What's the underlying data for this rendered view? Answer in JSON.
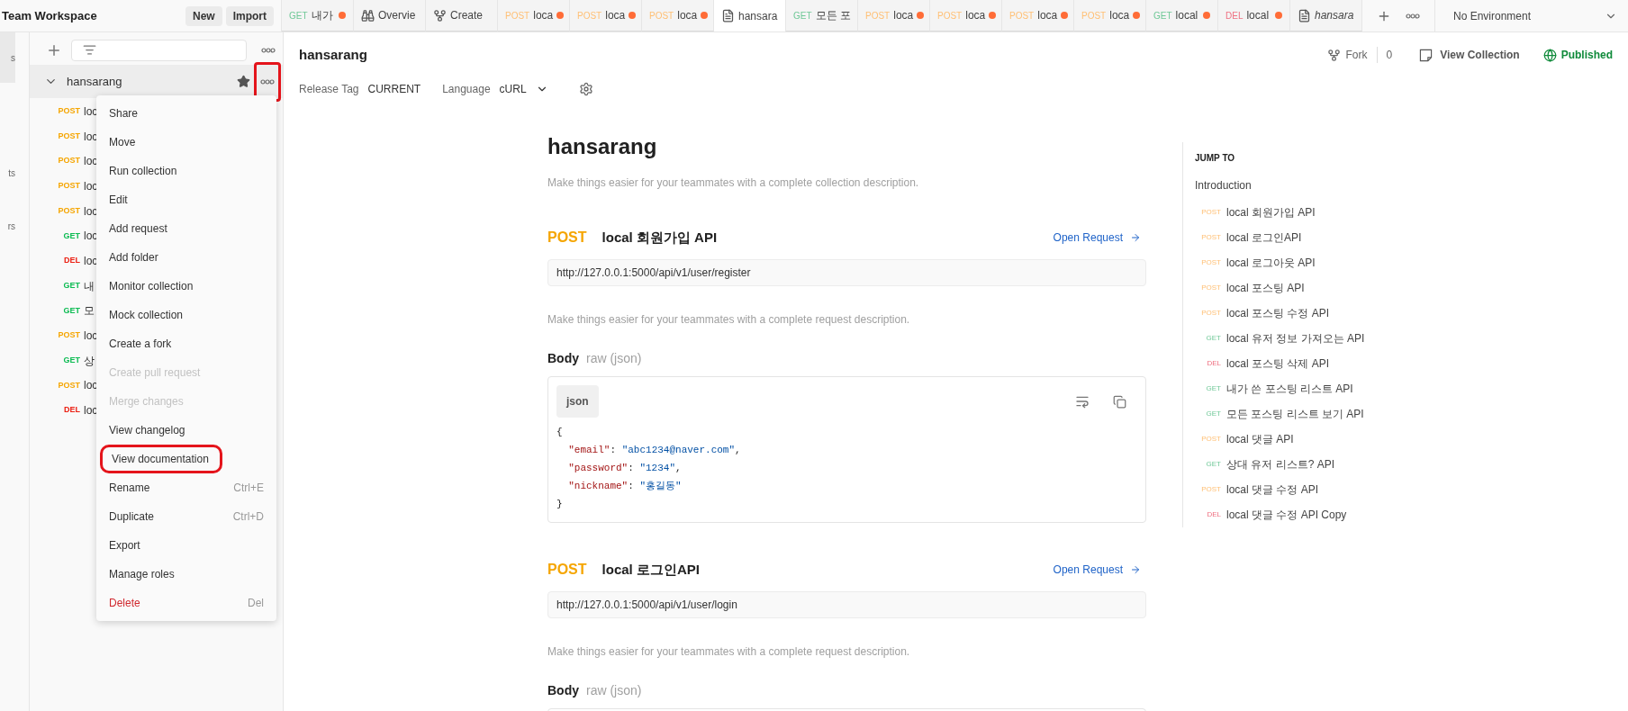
{
  "workspace": {
    "title": "Team Workspace",
    "buttons": [
      "New",
      "Import"
    ]
  },
  "tabs": [
    {
      "kind": "request",
      "method": "GET",
      "label": "내가",
      "unsaved": true,
      "selected": false,
      "preview": false
    },
    {
      "kind": "overview",
      "label": "Overvie",
      "unsaved": false,
      "selected": false,
      "preview": false
    },
    {
      "kind": "fork",
      "label": "Create",
      "unsaved": false,
      "selected": false,
      "preview": false
    },
    {
      "kind": "request",
      "method": "POST",
      "label": "loca",
      "unsaved": true,
      "selected": false,
      "preview": false
    },
    {
      "kind": "request",
      "method": "POST",
      "label": "loca",
      "unsaved": true,
      "selected": false,
      "preview": false
    },
    {
      "kind": "request",
      "method": "POST",
      "label": "loca",
      "unsaved": true,
      "selected": false,
      "preview": false
    },
    {
      "kind": "collection",
      "label": "hansara",
      "unsaved": false,
      "selected": true,
      "preview": false
    },
    {
      "kind": "request",
      "method": "GET",
      "label": "모든 포",
      "unsaved": false,
      "selected": false,
      "preview": false
    },
    {
      "kind": "request",
      "method": "POST",
      "label": "loca",
      "unsaved": true,
      "selected": false,
      "preview": false
    },
    {
      "kind": "request",
      "method": "POST",
      "label": "loca",
      "unsaved": true,
      "selected": false,
      "preview": false
    },
    {
      "kind": "request",
      "method": "POST",
      "label": "loca",
      "unsaved": true,
      "selected": false,
      "preview": false
    },
    {
      "kind": "request",
      "method": "POST",
      "label": "loca",
      "unsaved": true,
      "selected": false,
      "preview": false
    },
    {
      "kind": "request",
      "method": "GET",
      "label": "local",
      "unsaved": true,
      "selected": false,
      "preview": false
    },
    {
      "kind": "request",
      "method": "DEL",
      "label": "local",
      "unsaved": true,
      "selected": false,
      "preview": false
    },
    {
      "kind": "collection",
      "label": "hansara",
      "unsaved": false,
      "selected": false,
      "preview": true
    }
  ],
  "environment": {
    "label": "No Environment"
  },
  "nav_strip": [
    {
      "label": "s",
      "selected": true
    },
    {
      "label": "ts",
      "selected": false
    },
    {
      "label": "rs",
      "selected": false
    }
  ],
  "sidebar": {
    "collection": {
      "name": "hansarang",
      "expanded": true,
      "starred": true,
      "more_annotated": true,
      "requests": [
        {
          "method": "POST",
          "name": "loc"
        },
        {
          "method": "POST",
          "name": "loc"
        },
        {
          "method": "POST",
          "name": "loc"
        },
        {
          "method": "POST",
          "name": "loc"
        },
        {
          "method": "POST",
          "name": "loc"
        },
        {
          "method": "GET",
          "name": "loc"
        },
        {
          "method": "DEL",
          "name": "loc"
        },
        {
          "method": "GET",
          "name": "내"
        },
        {
          "method": "GET",
          "name": "모"
        },
        {
          "method": "POST",
          "name": "loc"
        },
        {
          "method": "GET",
          "name": "상"
        },
        {
          "method": "POST",
          "name": "loc"
        },
        {
          "method": "DEL",
          "name": "loc"
        }
      ]
    }
  },
  "context_menu": [
    {
      "label": "Share",
      "disabled": false,
      "kind": "normal",
      "annotated": false
    },
    {
      "label": "Move",
      "disabled": false,
      "kind": "normal",
      "annotated": false
    },
    {
      "label": "Run collection",
      "disabled": false,
      "kind": "normal",
      "annotated": false
    },
    {
      "label": "Edit",
      "disabled": false,
      "kind": "normal",
      "annotated": false
    },
    {
      "label": "Add request",
      "disabled": false,
      "kind": "normal",
      "annotated": false
    },
    {
      "label": "Add folder",
      "disabled": false,
      "kind": "normal",
      "annotated": false
    },
    {
      "label": "Monitor collection",
      "disabled": false,
      "kind": "normal",
      "annotated": false
    },
    {
      "label": "Mock collection",
      "disabled": false,
      "kind": "normal",
      "annotated": false
    },
    {
      "label": "Create a fork",
      "disabled": false,
      "kind": "normal",
      "annotated": false
    },
    {
      "label": "Create pull request",
      "disabled": true,
      "kind": "normal",
      "annotated": false
    },
    {
      "label": "Merge changes",
      "disabled": true,
      "kind": "normal",
      "annotated": false
    },
    {
      "label": "View changelog",
      "disabled": false,
      "kind": "normal",
      "annotated": false
    },
    {
      "label": "View documentation",
      "disabled": false,
      "kind": "normal",
      "annotated": true
    },
    {
      "label": "Rename",
      "shortcut": "Ctrl+E",
      "disabled": false,
      "kind": "normal",
      "annotated": false
    },
    {
      "label": "Duplicate",
      "shortcut": "Ctrl+D",
      "disabled": false,
      "kind": "normal",
      "annotated": false
    },
    {
      "label": "Export",
      "disabled": false,
      "kind": "normal",
      "annotated": false
    },
    {
      "label": "Manage roles",
      "disabled": false,
      "kind": "normal",
      "annotated": false
    },
    {
      "label": "Delete",
      "shortcut": "Del",
      "disabled": false,
      "kind": "danger",
      "annotated": false
    }
  ],
  "header": {
    "title": "hansarang",
    "fork_label": "Fork",
    "fork_count": "0",
    "view_collection": "View Collection",
    "status": "Published",
    "release_tag_label": "Release Tag",
    "release_tag": "CURRENT",
    "language_label": "Language",
    "language": "cURL"
  },
  "doc": {
    "title": "hansarang",
    "description": "Make things easier for your teammates with a complete collection description.",
    "requests": [
      {
        "method": "POST",
        "name": "local 회원가입 API",
        "open_label": "Open Request",
        "url": "http://127.0.0.1:5000/api/v1/user/register",
        "description": "Make things easier for your teammates with a complete request description.",
        "body_label": "Body",
        "body_type": "raw (json)",
        "code_lang": "json",
        "code": [
          [
            {
              "kind": "punct",
              "text": "{"
            }
          ],
          [
            {
              "kind": "key",
              "text": "  \"email\""
            },
            {
              "kind": "punct",
              "text": ": "
            },
            {
              "kind": "string",
              "text": "\"abc1234@naver.com\""
            },
            {
              "kind": "punct",
              "text": ","
            }
          ],
          [
            {
              "kind": "key",
              "text": "  \"password\""
            },
            {
              "kind": "punct",
              "text": ": "
            },
            {
              "kind": "string",
              "text": "\"1234\""
            },
            {
              "kind": "punct",
              "text": ","
            }
          ],
          [
            {
              "kind": "key",
              "text": "  \"nickname\""
            },
            {
              "kind": "punct",
              "text": ": "
            },
            {
              "kind": "string",
              "text": "\"홍길동\""
            }
          ],
          [
            {
              "kind": "punct",
              "text": "}"
            }
          ]
        ]
      },
      {
        "method": "POST",
        "name": "local 로그인API",
        "open_label": "Open Request",
        "url": "http://127.0.0.1:5000/api/v1/user/login",
        "description": "Make things easier for your teammates with a complete request description.",
        "body_label": "Body",
        "body_type": "raw (json)"
      }
    ]
  },
  "jump_to": {
    "title": "JUMP TO",
    "items": [
      {
        "kind": "intro",
        "label": "Introduction"
      },
      {
        "kind": "request",
        "method": "POST",
        "label": "local 회원가입 API"
      },
      {
        "kind": "request",
        "method": "POST",
        "label": "local 로그인API"
      },
      {
        "kind": "request",
        "method": "POST",
        "label": "local 로그아웃 API"
      },
      {
        "kind": "request",
        "method": "POST",
        "label": "local 포스팅 API"
      },
      {
        "kind": "request",
        "method": "POST",
        "label": "local 포스팅 수정 API"
      },
      {
        "kind": "request",
        "method": "GET",
        "label": "local 유저 정보 가져오는 API"
      },
      {
        "kind": "request",
        "method": "DEL",
        "label": "local 포스팅 삭제 API"
      },
      {
        "kind": "request",
        "method": "GET",
        "label": "내가 쓴 포스팅 리스트 API"
      },
      {
        "kind": "request",
        "method": "GET",
        "label": "모든 포스팅 리스트 보기 API"
      },
      {
        "kind": "request",
        "method": "POST",
        "label": "local 댓글 API"
      },
      {
        "kind": "request",
        "method": "GET",
        "label": "상대 유저 리스트? API"
      },
      {
        "kind": "request",
        "method": "POST",
        "label": "local 댓글 수정 API"
      },
      {
        "kind": "request",
        "method": "DEL",
        "label": "local 댓글 수정 API Copy"
      }
    ]
  }
}
